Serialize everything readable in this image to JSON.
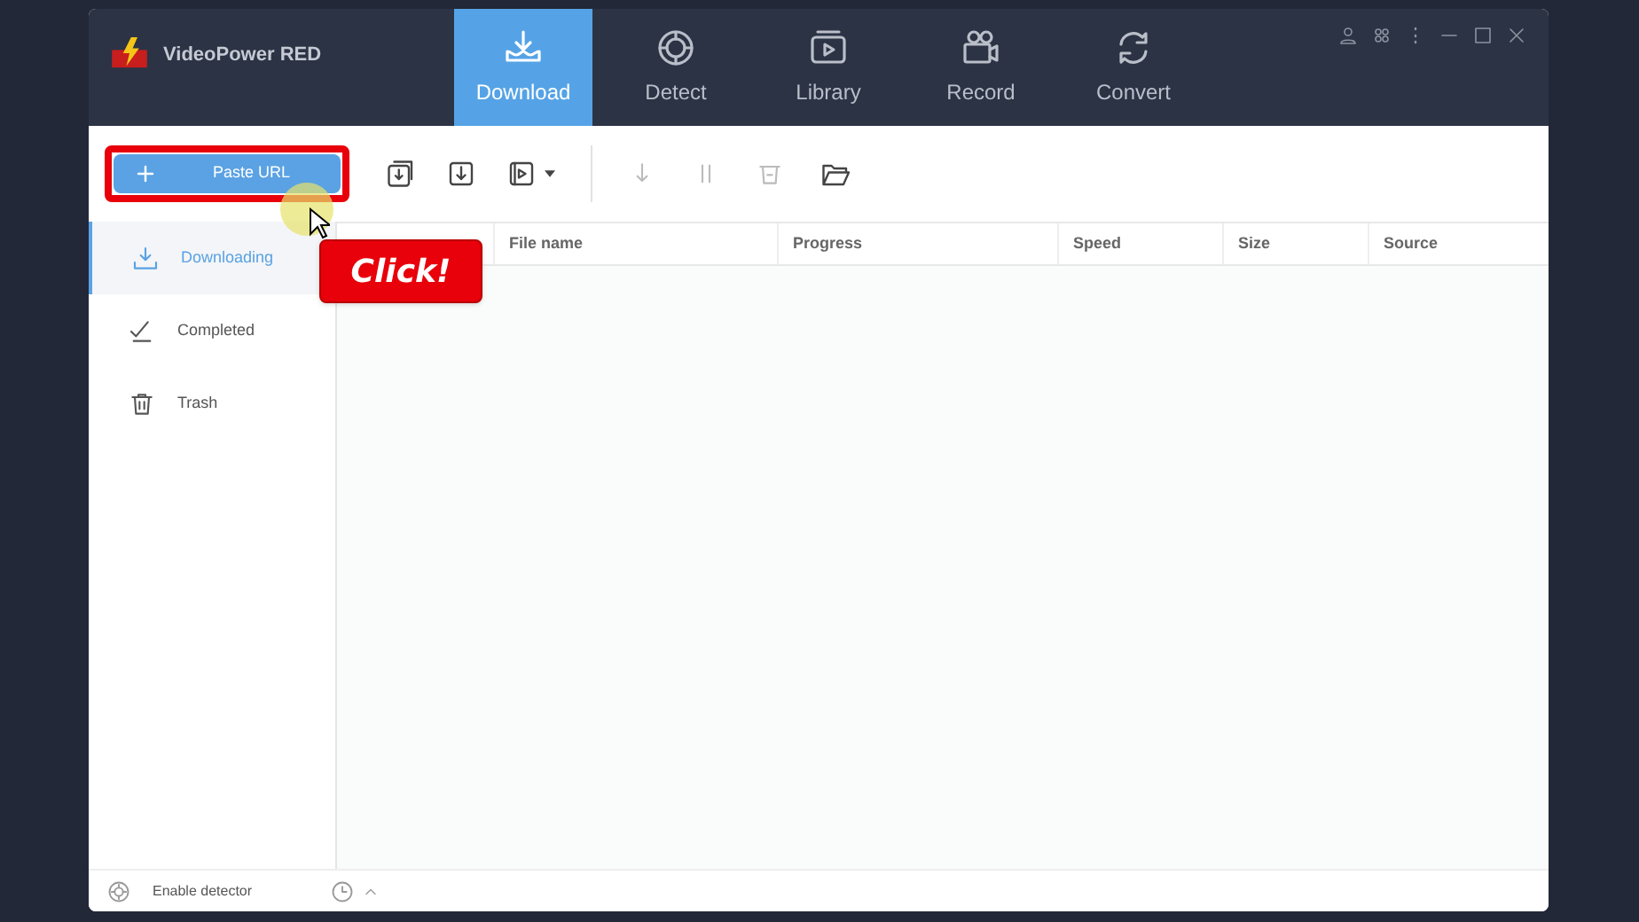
{
  "app": {
    "title": "VideoPower RED"
  },
  "nav_tabs": [
    {
      "label": "Download",
      "selected": true
    },
    {
      "label": "Detect",
      "selected": false
    },
    {
      "label": "Library",
      "selected": false
    },
    {
      "label": "Record",
      "selected": false
    },
    {
      "label": "Convert",
      "selected": false
    }
  ],
  "toolbar": {
    "paste_button": "Paste URL"
  },
  "sidebar": {
    "items": [
      {
        "label": "Downloading",
        "selected": true
      },
      {
        "label": "Completed",
        "selected": false
      },
      {
        "label": "Trash",
        "selected": false
      }
    ]
  },
  "table": {
    "columns": [
      "File name",
      "Progress",
      "Speed",
      "Size",
      "Source"
    ]
  },
  "status_bar": {
    "detector": "Enable detector"
  },
  "annotation": {
    "callout": "Click!"
  }
}
